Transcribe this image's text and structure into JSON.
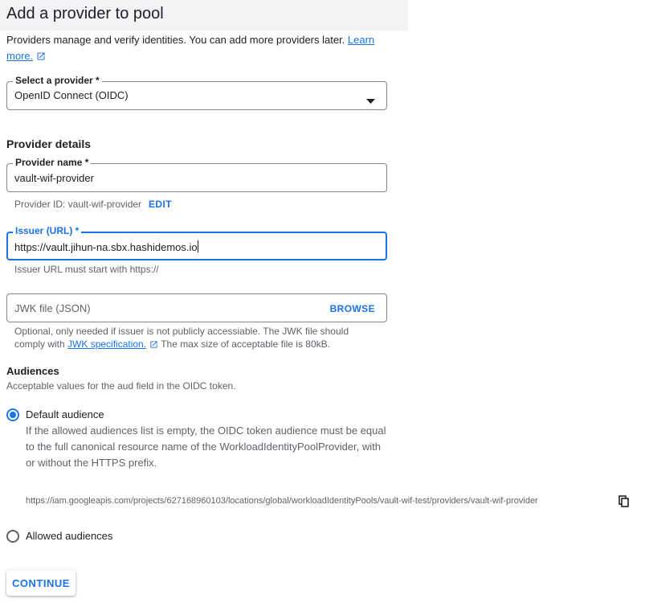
{
  "header": {
    "title": "Add a provider to pool"
  },
  "intro": {
    "text": "Providers manage and verify identities. You can add more providers later. ",
    "link_part1": "Learn",
    "link_part2": "more."
  },
  "provider_select": {
    "label": "Select a provider *",
    "value": "OpenID Connect (OIDC)"
  },
  "provider_details": {
    "heading": "Provider details",
    "name_label": "Provider name *",
    "name_value": "vault-wif-provider",
    "provider_id_text": "Provider ID: vault-wif-provider",
    "edit_label": "EDIT",
    "issuer_label": "Issuer (URL) *",
    "issuer_value": "https://vault.jihun-na.sbx.hashidemos.io",
    "issuer_helper": "Issuer URL must start with https://",
    "jwk_placeholder": "JWK file (JSON)",
    "browse_label": "BROWSE",
    "jwk_helper_1": "Optional, only needed if issuer is not publicly accessiable. The JWK file should",
    "jwk_helper_2a": "comply with ",
    "jwk_link": "JWK specification.",
    "jwk_helper_2b": " The max size of acceptable file is 80kB."
  },
  "audiences": {
    "heading": "Audiences",
    "description": "Acceptable values for the aud field in the OIDC token.",
    "default_label": "Default audience",
    "default_desc_1": "If the allowed audiences list is empty, the OIDC token audience must be equal",
    "default_desc_2": "to the full canonical resource name of the WorkloadIdentityPoolProvider, with",
    "default_desc_3": "or without the HTTPS prefix.",
    "default_url": "https://iam.googleapis.com/projects/627168960103/locations/global/workloadIdentityPools/vault-wif-test/providers/vault-wif-provider",
    "allowed_label": "Allowed audiences",
    "selected": "default"
  },
  "actions": {
    "continue_label": "CONTINUE"
  },
  "icons": {
    "external_link": "open-in-new-icon",
    "copy": "copy-icon",
    "dropdown": "arrow-drop-down-icon"
  },
  "colors": {
    "accent": "#1a73e8",
    "header_bg": "#f1f3f4",
    "helper_text": "#5f6368"
  }
}
